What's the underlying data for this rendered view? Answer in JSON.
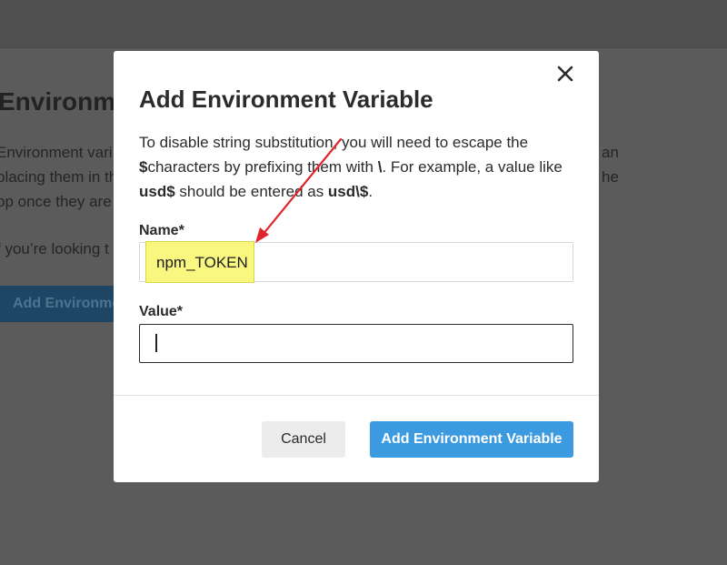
{
  "background": {
    "heading": "Environmen",
    "lines": [
      "Environment vari",
      "placing them in th",
      "pp once they are",
      "f you’re looking t"
    ],
    "right_fragments": [
      "an",
      "he"
    ],
    "button_label": "Add Environmen"
  },
  "modal": {
    "title": "Add Environment Variable",
    "description": {
      "part1": "To disable string substitution, you will need to escape the ",
      "dollar": "$",
      "part2": "characters by prefixing them with ",
      "backslash": "\\",
      "part3": ". For example, a value like ",
      "example": "usd$",
      "part4": " should be entered as ",
      "escaped": "usd\\$",
      "part5": "."
    },
    "name_label": "Name*",
    "name_value": "npm_TOKEN",
    "value_label": "Value*",
    "value_value": "",
    "cancel_label": "Cancel",
    "submit_label": "Add Environment Variable"
  },
  "icons": {
    "close": "close-icon"
  },
  "colors": {
    "primary": "#3c9be0",
    "highlight": "#f9f77f",
    "annotation_arrow": "#e0262c"
  }
}
